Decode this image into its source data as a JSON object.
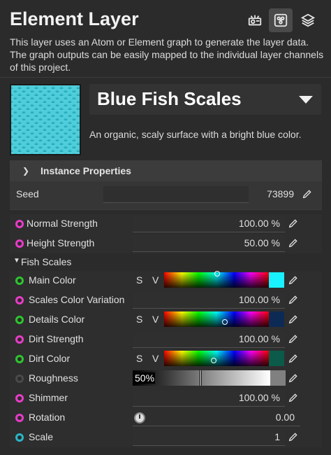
{
  "header": {
    "title": "Element Layer",
    "icons": [
      "projector-icon",
      "element-graph-icon",
      "layers-icon"
    ]
  },
  "description": "This layer uses an Atom or Element graph to generate the layer data. The graph outputs can be easily mapped to the individual layer channels of this project.",
  "material": {
    "name": "Blue Fish Scales",
    "description": "An organic, scaly surface with a bright blue color."
  },
  "instance_properties": {
    "label": "Instance Properties",
    "seed_label": "Seed",
    "seed_value": "73899"
  },
  "params": {
    "normal_strength": {
      "label": "Normal Strength",
      "value": "100.00 %"
    },
    "height_strength": {
      "label": "Height Strength",
      "value": "50.00 %"
    }
  },
  "fish_scales": {
    "label": "Fish Scales",
    "s_label": "S",
    "v_label": "V",
    "main_color": {
      "label": "Main Color",
      "color": "#18f2ff"
    },
    "scales_color_variation": {
      "label": "Scales Color Variation",
      "value": "100.00 %"
    },
    "details_color": {
      "label": "Details Color",
      "color": "#0d2a55"
    },
    "dirt_strength": {
      "label": "Dirt Strength",
      "value": "100.00 %"
    },
    "dirt_color": {
      "label": "Dirt Color",
      "color": "#0c5a4a"
    },
    "roughness": {
      "label": "Roughness",
      "value": "50%"
    },
    "shimmer": {
      "label": "Shimmer",
      "value": "100.00 %"
    },
    "rotation": {
      "label": "Rotation",
      "value": "0.00"
    },
    "scale": {
      "label": "Scale",
      "value": "1"
    }
  }
}
